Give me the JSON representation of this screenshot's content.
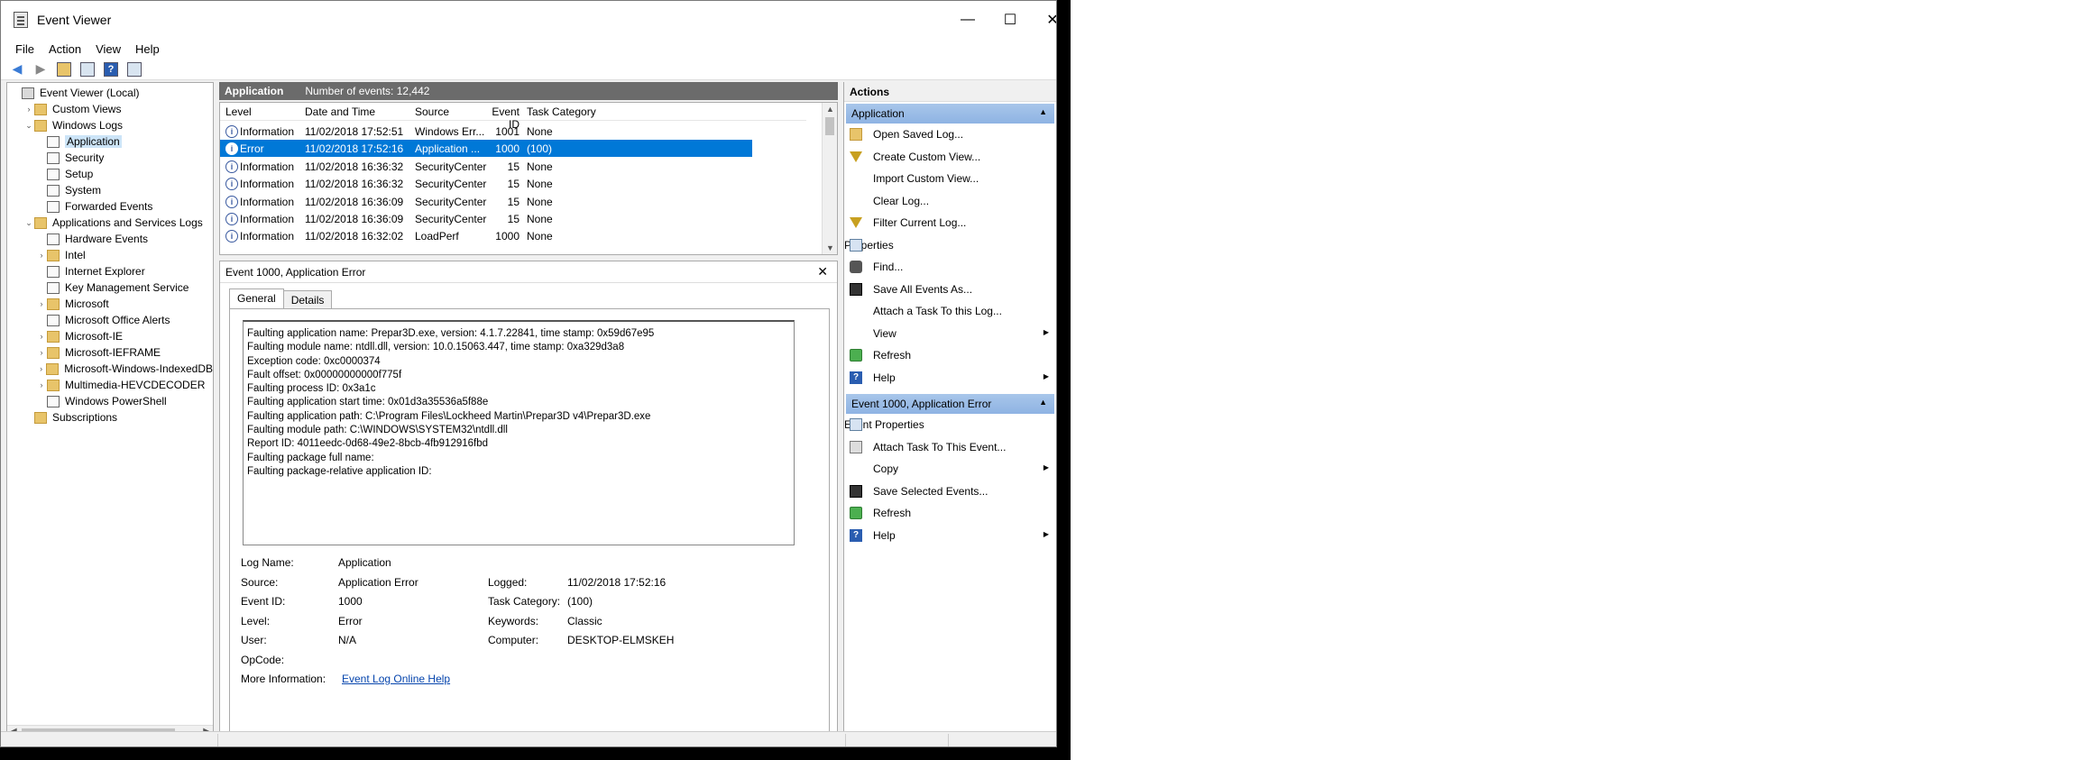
{
  "window": {
    "title": "Event Viewer",
    "minimize": "—",
    "maximize": "☐",
    "close": "✕"
  },
  "menu": [
    "File",
    "Action",
    "View",
    "Help"
  ],
  "tree": [
    {
      "label": "Event Viewer (Local)",
      "indent": 0,
      "arrow": "",
      "icon": "comp"
    },
    {
      "label": "Custom Views",
      "indent": 1,
      "arrow": "›",
      "icon": "folder"
    },
    {
      "label": "Windows Logs",
      "indent": 1,
      "arrow": "⌄",
      "icon": "folder"
    },
    {
      "label": "Application",
      "indent": 2,
      "arrow": "",
      "icon": "log",
      "selected": true
    },
    {
      "label": "Security",
      "indent": 2,
      "arrow": "",
      "icon": "log"
    },
    {
      "label": "Setup",
      "indent": 2,
      "arrow": "",
      "icon": "log"
    },
    {
      "label": "System",
      "indent": 2,
      "arrow": "",
      "icon": "log"
    },
    {
      "label": "Forwarded Events",
      "indent": 2,
      "arrow": "",
      "icon": "log"
    },
    {
      "label": "Applications and Services Logs",
      "indent": 1,
      "arrow": "⌄",
      "icon": "folder"
    },
    {
      "label": "Hardware Events",
      "indent": 2,
      "arrow": "",
      "icon": "log"
    },
    {
      "label": "Intel",
      "indent": 2,
      "arrow": "›",
      "icon": "folder"
    },
    {
      "label": "Internet Explorer",
      "indent": 2,
      "arrow": "",
      "icon": "log"
    },
    {
      "label": "Key Management Service",
      "indent": 2,
      "arrow": "",
      "icon": "log"
    },
    {
      "label": "Microsoft",
      "indent": 2,
      "arrow": "›",
      "icon": "folder"
    },
    {
      "label": "Microsoft Office Alerts",
      "indent": 2,
      "arrow": "",
      "icon": "log"
    },
    {
      "label": "Microsoft-IE",
      "indent": 2,
      "arrow": "›",
      "icon": "folder"
    },
    {
      "label": "Microsoft-IEFRAME",
      "indent": 2,
      "arrow": "›",
      "icon": "folder"
    },
    {
      "label": "Microsoft-Windows-IndexedDB",
      "indent": 2,
      "arrow": "›",
      "icon": "folder"
    },
    {
      "label": "Multimedia-HEVCDECODER",
      "indent": 2,
      "arrow": "›",
      "icon": "folder"
    },
    {
      "label": "Windows PowerShell",
      "indent": 2,
      "arrow": "",
      "icon": "log"
    },
    {
      "label": "Subscriptions",
      "indent": 1,
      "arrow": "",
      "icon": "folder"
    }
  ],
  "list": {
    "name": "Application",
    "count": "Number of events: 12,442",
    "columns": [
      "Level",
      "Date and Time",
      "Source",
      "Event ID",
      "Task Category"
    ],
    "rows": [
      {
        "level": "Information",
        "date": "11/02/2018 17:52:51",
        "source": "Windows Err...",
        "id": "1001",
        "cat": "None"
      },
      {
        "level": "Error",
        "date": "11/02/2018 17:52:16",
        "source": "Application ...",
        "id": "1000",
        "cat": "(100)",
        "selected": true
      },
      {
        "level": "Information",
        "date": "11/02/2018 16:36:32",
        "source": "SecurityCenter",
        "id": "15",
        "cat": "None"
      },
      {
        "level": "Information",
        "date": "11/02/2018 16:36:32",
        "source": "SecurityCenter",
        "id": "15",
        "cat": "None"
      },
      {
        "level": "Information",
        "date": "11/02/2018 16:36:09",
        "source": "SecurityCenter",
        "id": "15",
        "cat": "None"
      },
      {
        "level": "Information",
        "date": "11/02/2018 16:36:09",
        "source": "SecurityCenter",
        "id": "15",
        "cat": "None"
      },
      {
        "level": "Information",
        "date": "11/02/2018 16:32:02",
        "source": "LoadPerf",
        "id": "1000",
        "cat": "None"
      }
    ]
  },
  "detail": {
    "title": "Event 1000, Application Error",
    "close": "✕",
    "tabs": [
      "General",
      "Details"
    ],
    "description": "Faulting application name: Prepar3D.exe, version: 4.1.7.22841, time stamp: 0x59d67e95\nFaulting module name: ntdll.dll, version: 10.0.15063.447, time stamp: 0xa329d3a8\nException code: 0xc0000374\nFault offset: 0x00000000000f775f\nFaulting process ID: 0x3a1c\nFaulting application start time: 0x01d3a35536a5f88e\nFaulting application path: C:\\Program Files\\Lockheed Martin\\Prepar3D v4\\Prepar3D.exe\nFaulting module path: C:\\WINDOWS\\SYSTEM32\\ntdll.dll\nReport ID: 4011eedc-0d68-49e2-8bcb-4fb912916fbd\nFaulting package full name:\nFaulting package-relative application ID:",
    "props": {
      "log_name_l": "Log Name:",
      "log_name": "Application",
      "source_l": "Source:",
      "source": "Application Error",
      "logged_l": "Logged:",
      "logged": "11/02/2018 17:52:16",
      "event_id_l": "Event ID:",
      "event_id": "1000",
      "task_l": "Task Category:",
      "task": "(100)",
      "level_l": "Level:",
      "level": "Error",
      "keywords_l": "Keywords:",
      "keywords": "Classic",
      "user_l": "User:",
      "user": "N/A",
      "computer_l": "Computer:",
      "computer": "DESKTOP-ELMSKEH",
      "opcode_l": "OpCode:",
      "more_l": "More Information:",
      "more_link": "Event Log Online Help"
    }
  },
  "actions": {
    "title": "Actions",
    "section1": "Application",
    "items1": [
      {
        "label": "Open Saved Log...",
        "icon": "fold"
      },
      {
        "label": "Create Custom View...",
        "icon": "filt"
      },
      {
        "label": "Import Custom View...",
        "icon": "none"
      },
      {
        "label": "Clear Log...",
        "icon": "none"
      },
      {
        "label": "Filter Current Log...",
        "icon": "filt"
      },
      {
        "label": "Properties",
        "icon": "prop"
      },
      {
        "label": "Find...",
        "icon": "find"
      },
      {
        "label": "Save All Events As...",
        "icon": "save"
      },
      {
        "label": "Attach a Task To this Log...",
        "icon": "none"
      },
      {
        "label": "View",
        "icon": "none",
        "sub": true
      },
      {
        "label": "Refresh",
        "icon": "refr"
      },
      {
        "label": "Help",
        "icon": "help",
        "sub": true
      }
    ],
    "section2": "Event 1000, Application Error",
    "items2": [
      {
        "label": "Event Properties",
        "icon": "prop"
      },
      {
        "label": "Attach Task To This Event...",
        "icon": "task"
      },
      {
        "label": "Copy",
        "icon": "none",
        "sub": true
      },
      {
        "label": "Save Selected Events...",
        "icon": "save"
      },
      {
        "label": "Refresh",
        "icon": "refr"
      },
      {
        "label": "Help",
        "icon": "help",
        "sub": true
      }
    ]
  }
}
